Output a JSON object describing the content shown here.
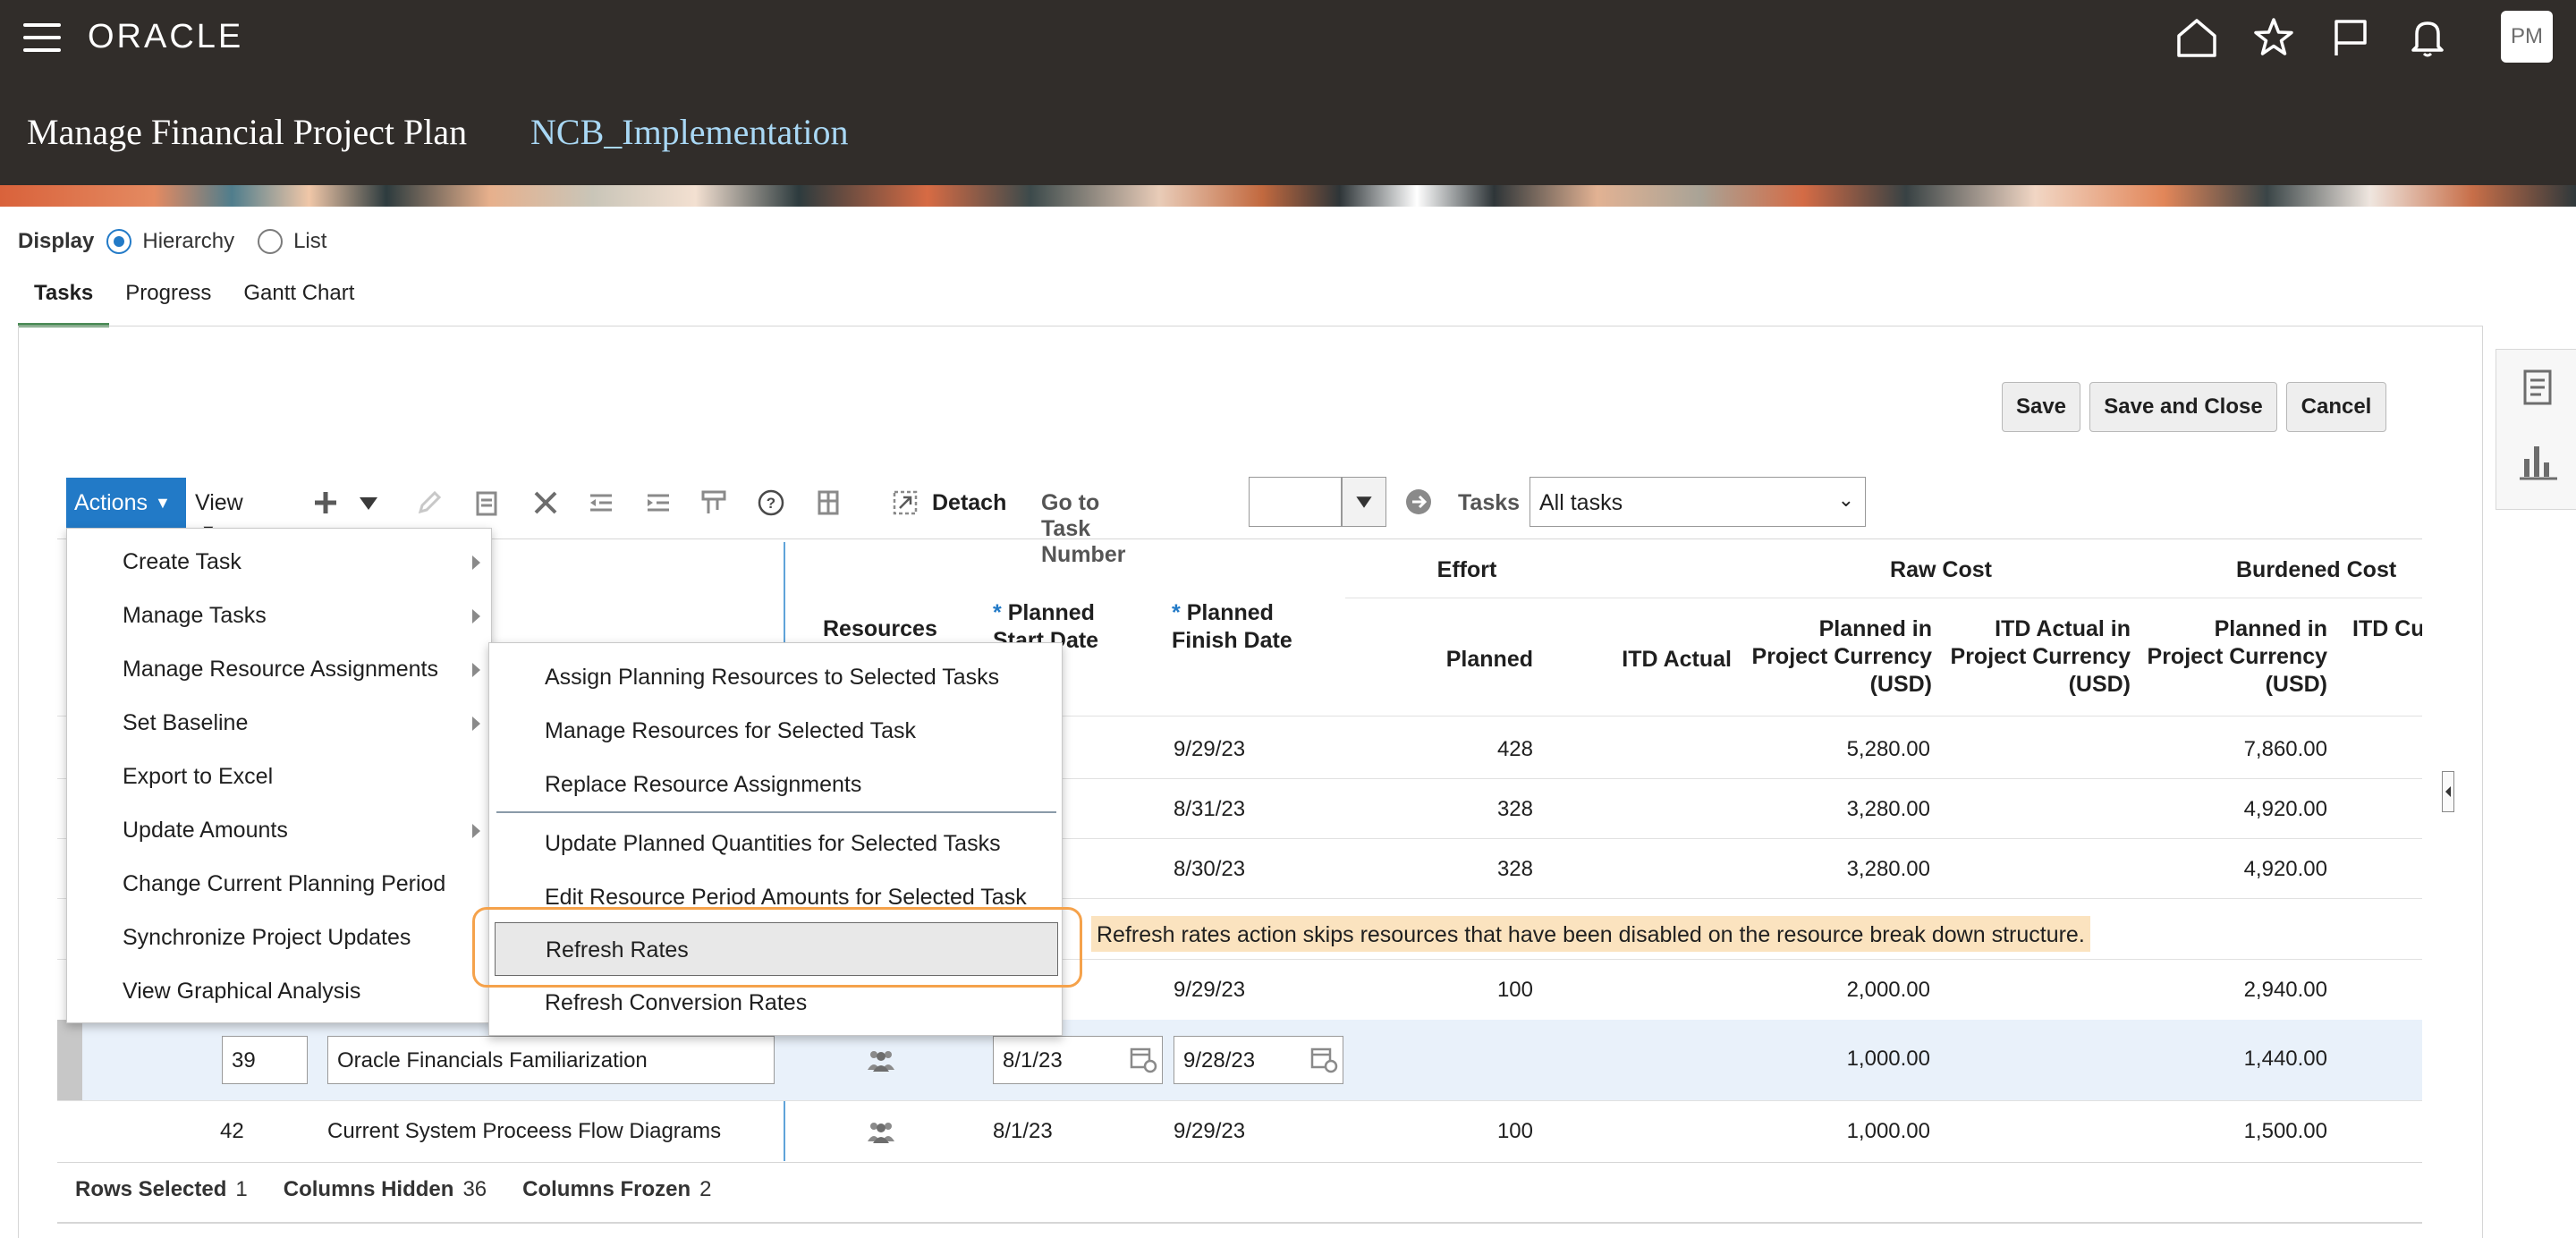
{
  "header": {
    "brand": "ORACLE",
    "page_title": "Manage Financial Project Plan",
    "project_name": "NCB_Implementation",
    "user_initials": "PM"
  },
  "display": {
    "label": "Display",
    "options": [
      "Hierarchy",
      "List"
    ],
    "selected": "Hierarchy"
  },
  "tabs": [
    "Tasks",
    "Progress",
    "Gantt Chart"
  ],
  "buttons": {
    "save": "Save",
    "save_close": "Save and Close",
    "cancel": "Cancel"
  },
  "toolbar": {
    "actions": "Actions",
    "view": "View",
    "detach": "Detach",
    "goto_label": "Go to Task Number",
    "tasks_label": "Tasks",
    "tasks_value": "All tasks"
  },
  "table": {
    "headers": {
      "resources": "Resources",
      "planned_start": "Planned Start Date",
      "planned_finish": "Planned Finish Date",
      "group_effort": "Effort",
      "group_raw": "Raw Cost",
      "group_burdened": "Burdened Cost",
      "effort_planned": "Planned",
      "effort_itd": "ITD Actual",
      "raw_planned": "Planned in Project Currency (USD)",
      "raw_itd": "ITD Actual in Project Currency (USD)",
      "burd_planned": "Planned in Project Currency (USD)",
      "burd_itd": "ITD Curren"
    },
    "rows": [
      {
        "finish": "9/29/23",
        "effort": "428",
        "raw": "5,280.00",
        "burdened": "7,860.00"
      },
      {
        "finish": "8/31/23",
        "effort": "328",
        "raw": "3,280.00",
        "burdened": "4,920.00"
      },
      {
        "finish": "8/30/23",
        "effort": "328",
        "raw": "3,280.00",
        "burdened": "4,920.00"
      },
      {
        "finish": "9/29/23",
        "effort": "100",
        "raw": "2,000.00",
        "burdened": "2,940.00"
      },
      {
        "number": "39",
        "name": "Oracle Financials Familiarization",
        "start": "8/1/23",
        "finish": "9/28/23",
        "effort": "",
        "raw": "1,000.00",
        "burdened": "1,440.00"
      },
      {
        "number": "42",
        "name": "Current System Proceess Flow Diagrams",
        "start": "8/1/23",
        "finish": "9/29/23",
        "effort": "100",
        "raw": "1,000.00",
        "burdened": "1,500.00"
      }
    ]
  },
  "footer": {
    "rows_selected_label": "Rows Selected",
    "rows_selected": "1",
    "columns_hidden_label": "Columns Hidden",
    "columns_hidden": "36",
    "columns_frozen_label": "Columns Frozen",
    "columns_frozen": "2"
  },
  "actions_menu": [
    {
      "label": "Create Task",
      "submenu": true
    },
    {
      "label": "Manage Tasks",
      "submenu": true
    },
    {
      "label": "Manage Resource Assignments",
      "submenu": true
    },
    {
      "label": "Set Baseline",
      "submenu": true
    },
    {
      "label": "Export to Excel",
      "submenu": false
    },
    {
      "label": "Update Amounts",
      "submenu": true
    },
    {
      "label": "Change Current Planning Period",
      "submenu": false
    },
    {
      "label": "Synchronize Project Updates",
      "submenu": false
    },
    {
      "label": "View Graphical Analysis",
      "submenu": false
    }
  ],
  "submenu": [
    "Assign Planning Resources to Selected Tasks",
    "Manage Resources for Selected Task",
    "Replace Resource Assignments",
    "Update Planned Quantities for Selected Tasks",
    "Edit Resource Period Amounts for Selected Task",
    "Refresh Rates",
    "Refresh Conversion Rates"
  ],
  "highlighted_item": "Refresh Rates",
  "annotation": "Refresh rates action skips resources that have been disabled on the resource break down structure.",
  "colors": {
    "header_bg": "#312d2a",
    "accent": "#227ac7",
    "highlight_border": "#f5a24b",
    "note_bg": "#fbe3bf"
  }
}
